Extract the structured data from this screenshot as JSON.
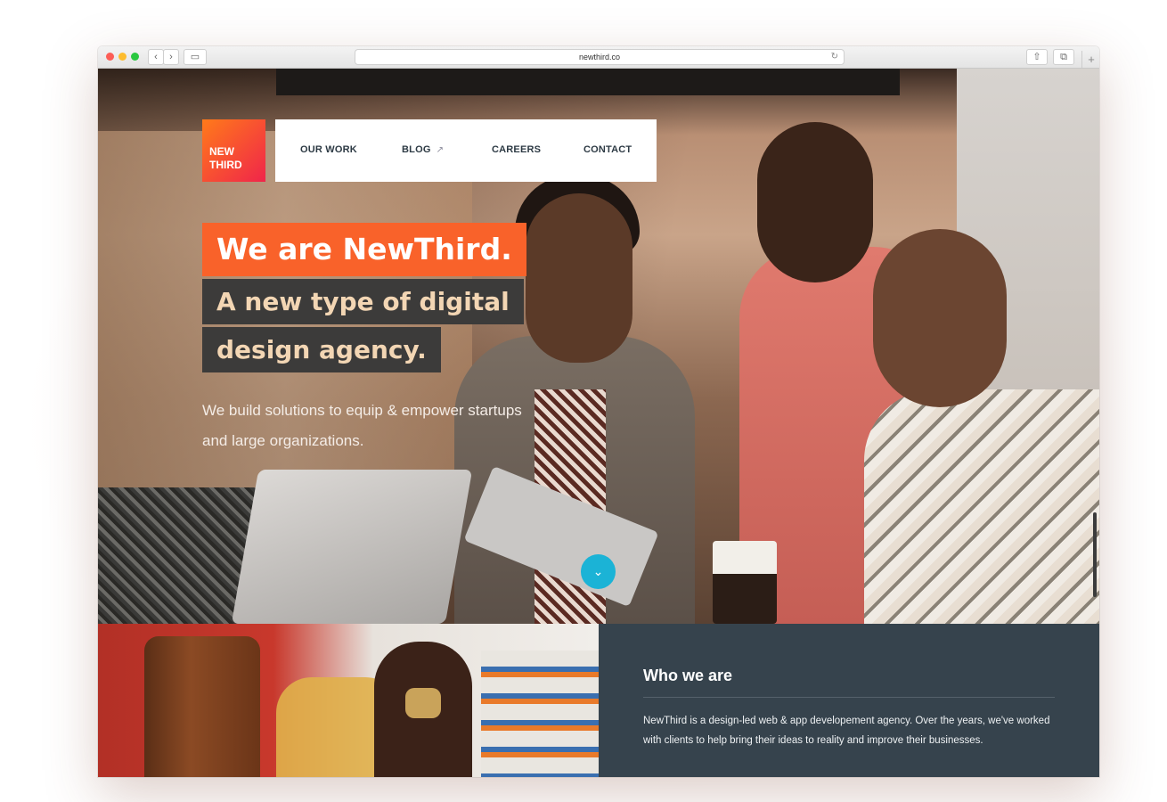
{
  "browser": {
    "url": "newthird.co",
    "back_icon": "‹",
    "forward_icon": "›",
    "sidebar_icon": "▭",
    "reload_icon": "↻",
    "share_icon": "⇧",
    "tabs_icon": "⧉",
    "newtab_icon": "+"
  },
  "nav": {
    "logo_line1": "NEW",
    "logo_line2": "THIRD",
    "items": [
      "OUR WORK",
      "BLOG",
      "CAREERS",
      "CONTACT"
    ],
    "blog_external_icon": "↗"
  },
  "hero": {
    "headline1": "We are NewThird.",
    "headline2": "A new type of digital",
    "headline3": "design agency.",
    "subtitle": "We build solutions to equip & empower startups and large organizations.",
    "scroll_icon": "⌄"
  },
  "who": {
    "title": "Who we are",
    "text": "NewThird is a design-led web & app developement agency. Over the years, we've worked with clients to help bring their ideas to reality and improve their businesses."
  },
  "colors": {
    "accent_orange": "#f9622a",
    "logo_gradient_end": "#f0254a",
    "dark_box": "#3c3b3a",
    "headline_cream": "#f3d6b4",
    "who_bg": "#36434d",
    "scroll_cyan": "#1bb3d6"
  }
}
